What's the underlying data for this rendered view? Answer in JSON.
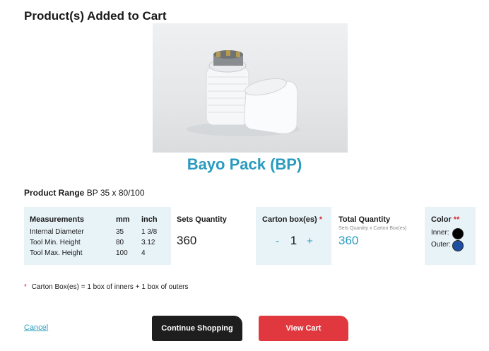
{
  "header": {
    "title": "Product(s) Added to Cart"
  },
  "product": {
    "name": "Bayo Pack (BP)",
    "range_label": "Product Range",
    "range_value": "BP 35 x 80/100"
  },
  "measurements": {
    "headers": [
      "Measurements",
      "mm",
      "inch"
    ],
    "rows": [
      {
        "label": "Internal Diameter",
        "mm": "35",
        "inch": "1 3/8"
      },
      {
        "label": "Tool Min. Height",
        "mm": "80",
        "inch": "3.12"
      },
      {
        "label": "Tool Max. Height",
        "mm": "100",
        "inch": "4"
      }
    ]
  },
  "sets": {
    "title": "Sets Quantity",
    "value": "360"
  },
  "carton": {
    "title": "Carton box(es)",
    "required_mark": "*",
    "minus": "-",
    "quantity": "1",
    "plus": "+"
  },
  "total": {
    "title": "Total Quantity",
    "subtitle": "Sets Quantity x Carton Box(es)",
    "value": "360"
  },
  "color": {
    "title": "Color",
    "required_mark": "**",
    "inner_label": "Inner:",
    "outer_label": "Outer:",
    "inner_color": "#000000",
    "outer_color": "#1f4fa3"
  },
  "note": {
    "mark": "*",
    "text": "Carton Box(es) = 1 box of inners + 1 box of outers"
  },
  "actions": {
    "cancel": "Cancel",
    "continue": "Continue Shopping",
    "view_cart": "View Cart"
  }
}
